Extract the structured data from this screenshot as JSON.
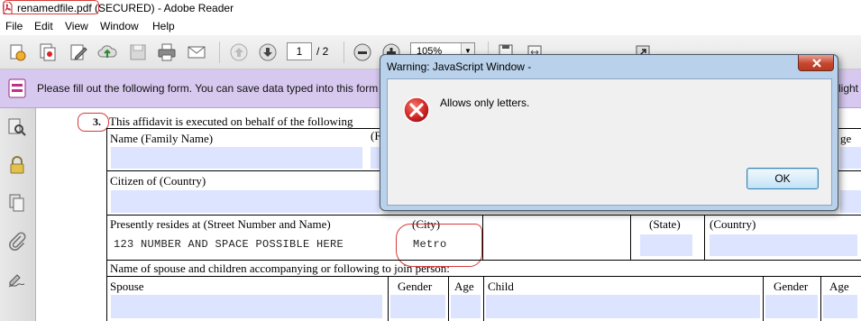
{
  "window": {
    "file_name": "renamedfile.pdf",
    "title_suffix": "(SECURED) - Adobe Reader"
  },
  "menu": [
    "File",
    "Edit",
    "View",
    "Window",
    "Help"
  ],
  "toolbar": {
    "page_current": "1",
    "page_total": "/ 2",
    "zoom": "105%"
  },
  "form_bar": {
    "message": "Please fill out the following form. You can save data typed into this form",
    "message_tail": "light"
  },
  "document": {
    "item_number": "3.",
    "affidavit_text": "This affidavit is executed on behalf of the following",
    "name_label": "Name    (Family Name)",
    "name_col_fragment": "(F",
    "age_fragment": "ge",
    "citizen_label": "Citizen of (Country)",
    "resides_label": "Presently resides at (Street Number and Name)",
    "city_label": "(City)",
    "state_label": "(State)",
    "country_label": "(Country)",
    "street_value": "123 NUMBER AND SPACE POSSIBLE HERE",
    "city_value": "Metro",
    "spouse_section_label": "Name of spouse and children accompanying or following to join person:",
    "spouse_label": "Spouse",
    "gender_label": "Gender",
    "age_label": "Age",
    "child_label": "Child",
    "gender_label_2": "Gender",
    "age_label_2": "Age"
  },
  "dialog": {
    "title": "Warning: JavaScript Window -",
    "message": "Allows only letters.",
    "ok_label": "OK"
  },
  "colors": {
    "form_bar": "#d6c8ee",
    "field_fill": "#dde4ff",
    "dialog_frame": "#b9d1ea",
    "error_red": "#d42a2a",
    "annotation_red": "#d43a3a"
  }
}
